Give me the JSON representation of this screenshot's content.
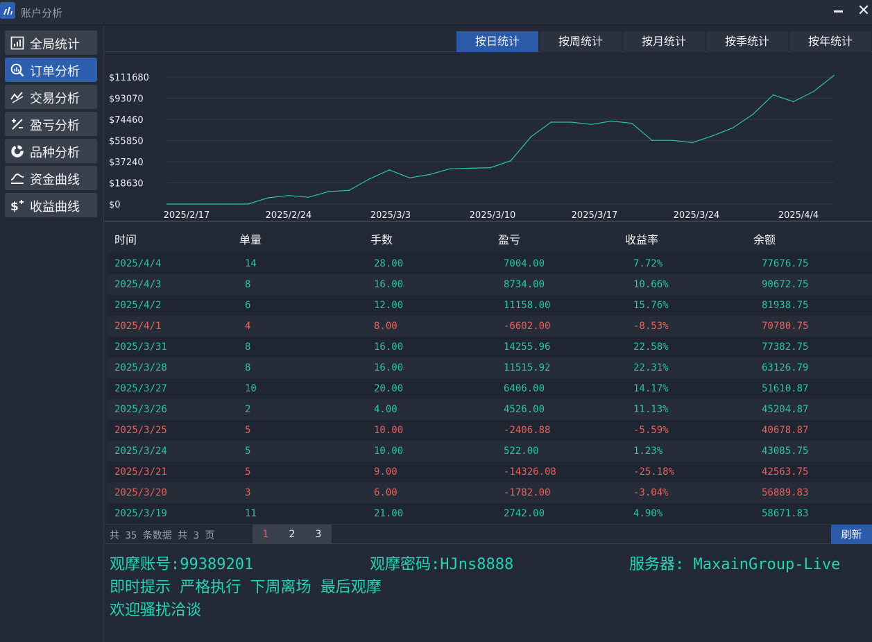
{
  "window": {
    "title": "账户分析",
    "minimize_icon": "minimize-icon",
    "close_label": "✕"
  },
  "sidebar": {
    "items": [
      {
        "label": "全局统计",
        "icon": "stats-icon"
      },
      {
        "label": "订单分析",
        "icon": "search-chart-icon",
        "active": true
      },
      {
        "label": "交易分析",
        "icon": "trend-icon"
      },
      {
        "label": "盈亏分析",
        "icon": "percent-icon"
      },
      {
        "label": "品种分析",
        "icon": "donut-icon"
      },
      {
        "label": "资金曲线",
        "icon": "curve-icon"
      },
      {
        "label": "收益曲线",
        "icon": "dollar-plus-icon"
      }
    ]
  },
  "tabs": [
    {
      "label": "按日统计",
      "active": true
    },
    {
      "label": "按周统计"
    },
    {
      "label": "按月统计"
    },
    {
      "label": "按季统计"
    },
    {
      "label": "按年统计"
    }
  ],
  "chart_data": {
    "type": "line",
    "title": "",
    "xlabel": "",
    "ylabel": "",
    "ylim": [
      0,
      111680
    ],
    "yticks": [
      "$111680",
      "$93070",
      "$74460",
      "$55850",
      "$37240",
      "$18630",
      "$0"
    ],
    "ytick_values": [
      111680,
      93070,
      74460,
      55850,
      37240,
      18630,
      0
    ],
    "xticks": [
      "2025/2/17",
      "2025/2/24",
      "2025/3/3",
      "2025/3/10",
      "2025/3/17",
      "2025/3/24",
      "2025/4/4"
    ],
    "grid": true,
    "color": "#2ec4a0",
    "series": [
      {
        "values": [
          0,
          0,
          0,
          0,
          0,
          5500,
          7500,
          6000,
          11000,
          12000,
          22000,
          30000,
          23000,
          26000,
          31000,
          31500,
          32000,
          38000,
          59000,
          72000,
          72000,
          70000,
          73000,
          71000,
          56000,
          56000,
          54000,
          60000,
          67000,
          79000,
          96000,
          90000,
          99000,
          113000
        ]
      }
    ]
  },
  "table": {
    "headers": [
      "时间",
      "单量",
      "手数",
      "盈亏",
      "收益率",
      "余额"
    ],
    "rows": [
      {
        "date": "2025/4/4",
        "count": "14",
        "lots": "28.00",
        "pl": "7004.00",
        "rate": "7.72%",
        "balance": "77676.75",
        "status": "gain"
      },
      {
        "date": "2025/4/3",
        "count": "8",
        "lots": "16.00",
        "pl": "8734.00",
        "rate": "10.66%",
        "balance": "90672.75",
        "status": "gain"
      },
      {
        "date": "2025/4/2",
        "count": "6",
        "lots": "12.00",
        "pl": "11158.00",
        "rate": "15.76%",
        "balance": "81938.75",
        "status": "gain"
      },
      {
        "date": "2025/4/1",
        "count": "4",
        "lots": "8.00",
        "pl": "-6602.00",
        "rate": "-8.53%",
        "balance": "70780.75",
        "status": "loss"
      },
      {
        "date": "2025/3/31",
        "count": "8",
        "lots": "16.00",
        "pl": "14255.96",
        "rate": "22.58%",
        "balance": "77382.75",
        "status": "gain"
      },
      {
        "date": "2025/3/28",
        "count": "8",
        "lots": "16.00",
        "pl": "11515.92",
        "rate": "22.31%",
        "balance": "63126.79",
        "status": "gain"
      },
      {
        "date": "2025/3/27",
        "count": "10",
        "lots": "20.00",
        "pl": "6406.00",
        "rate": "14.17%",
        "balance": "51610.87",
        "status": "gain"
      },
      {
        "date": "2025/3/26",
        "count": "2",
        "lots": "4.00",
        "pl": "4526.00",
        "rate": "11.13%",
        "balance": "45204.87",
        "status": "gain"
      },
      {
        "date": "2025/3/25",
        "count": "5",
        "lots": "10.00",
        "pl": "-2406.88",
        "rate": "-5.59%",
        "balance": "40678.87",
        "status": "loss"
      },
      {
        "date": "2025/3/24",
        "count": "5",
        "lots": "10.00",
        "pl": "522.00",
        "rate": "1.23%",
        "balance": "43085.75",
        "status": "gain"
      },
      {
        "date": "2025/3/21",
        "count": "5",
        "lots": "9.00",
        "pl": "-14326.08",
        "rate": "-25.18%",
        "balance": "42563.75",
        "status": "loss"
      },
      {
        "date": "2025/3/20",
        "count": "3",
        "lots": "6.00",
        "pl": "-1782.00",
        "rate": "-3.04%",
        "balance": "56889.83",
        "status": "loss"
      },
      {
        "date": "2025/3/19",
        "count": "11",
        "lots": "21.00",
        "pl": "2742.00",
        "rate": "4.90%",
        "balance": "58671.83",
        "status": "gain"
      }
    ]
  },
  "pager": {
    "info": "共 35 条数据 共 3 页",
    "pages": [
      "1",
      "2",
      "3"
    ],
    "current": "1",
    "refresh_label": "刷新"
  },
  "message": {
    "account": "观摩账号:99389201",
    "password": "观摩密码:HJns8888",
    "server": "服务器: MaxainGroup-Live",
    "line2": "即时提示 严格执行 下周离场 最后观摩",
    "line3": "欢迎骚扰洽谈"
  },
  "colors": {
    "accent": "#2a5aa8",
    "gain": "#2ec4a0",
    "loss": "#e8625f",
    "message": "#27d3b4"
  }
}
